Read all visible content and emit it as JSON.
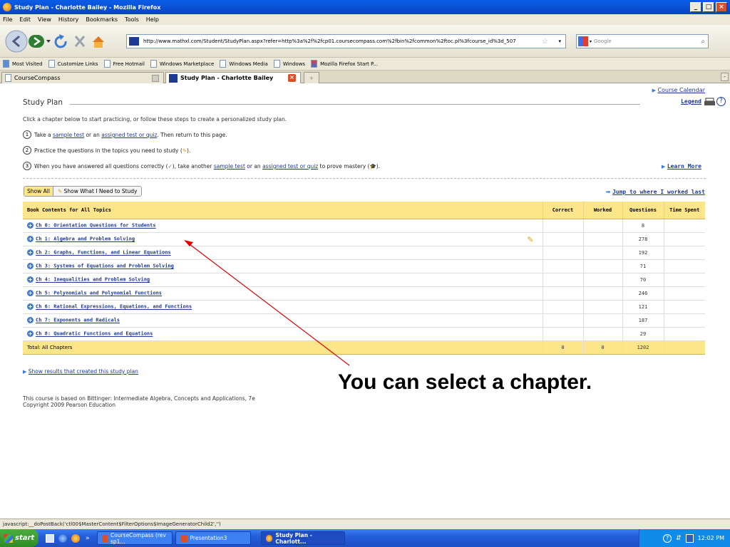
{
  "window": {
    "title": "Study Plan - Charlotte Bailey - Mozilla Firefox"
  },
  "menu": [
    "File",
    "Edit",
    "View",
    "History",
    "Bookmarks",
    "Tools",
    "Help"
  ],
  "address": {
    "url": "http://www.mathxl.com/Student/StudyPlan.aspx?refer=http%3a%2f%2fcp01.coursecompass.com%2fbin%2fcommon%2ftoc.pl%3fcourse_id%3d_507"
  },
  "search": {
    "placeholder": "Google"
  },
  "bookmarks": [
    "Most Visited",
    "Customize Links",
    "Free Hotmail",
    "Windows Marketplace",
    "Windows Media",
    "Windows",
    "Mozilla Firefox Start P..."
  ],
  "tabs": [
    "CourseCompass",
    "Study Plan - Charlotte Bailey"
  ],
  "page": {
    "title": "Study Plan",
    "course_calendar": "Course Calendar",
    "legend": "Legend",
    "intro": "Click a chapter below to start practicing, or follow these steps to create a personalized study plan.",
    "step1": {
      "num": "1",
      "a": "Take a ",
      "link1": "sample test",
      "b": " or an ",
      "link2": "assigned test or quiz",
      "c": ". Then return to this page."
    },
    "step2": {
      "num": "2",
      "a": "Practice the questions in the topics you need to study (",
      "c": ")."
    },
    "step3": {
      "num": "3",
      "a": "When you have answered all questions correctly (",
      "b": "), take another ",
      "link1": "sample test",
      "c": " or an ",
      "link2": "assigned test or quiz",
      "d": " to prove mastery (",
      "e": ")."
    },
    "learn_more": "Learn More",
    "filter": {
      "show_all": "Show All",
      "show_need": "Show What I Need to Study"
    },
    "jump": "Jump to where I worked last",
    "table": {
      "headers": {
        "topics": "Book Contents for All Topics",
        "correct": "Correct",
        "worked": "Worked",
        "questions": "Questions",
        "time": "Time Spent"
      },
      "rows": [
        {
          "chapter": "Ch 0: Orientation Questions for Students",
          "correct": "",
          "worked": "",
          "questions": "8",
          "time": ""
        },
        {
          "chapter": "Ch 1: Algebra and Problem Solving",
          "correct": "",
          "worked": "",
          "questions": "278",
          "time": ""
        },
        {
          "chapter": "Ch 2: Graphs, Functions, and Linear Equations",
          "correct": "",
          "worked": "",
          "questions": "192",
          "time": ""
        },
        {
          "chapter": "Ch 3: Systems of Equations and Problem Solving",
          "correct": "",
          "worked": "",
          "questions": "71",
          "time": ""
        },
        {
          "chapter": "Ch 4: Inequalities and Problem Solving",
          "correct": "",
          "worked": "",
          "questions": "70",
          "time": ""
        },
        {
          "chapter": "Ch 5: Polynomials and Polynomial Functions",
          "correct": "",
          "worked": "",
          "questions": "246",
          "time": ""
        },
        {
          "chapter": "Ch 6: Rational Expressions, Equations, and Functions",
          "correct": "",
          "worked": "",
          "questions": "121",
          "time": ""
        },
        {
          "chapter": "Ch 7: Exponents and Radicals",
          "correct": "",
          "worked": "",
          "questions": "187",
          "time": ""
        },
        {
          "chapter": "Ch 8: Quadratic Functions and Equations",
          "correct": "",
          "worked": "",
          "questions": "29",
          "time": ""
        }
      ],
      "total": {
        "label": "Total: All Chapters",
        "correct": "0",
        "worked": "0",
        "questions": "1202",
        "time": ""
      }
    },
    "show_results": "Show results that created this study plan",
    "footer_line1": "This course is based on Bittinger: Intermediate Algebra, Concepts and Applications, 7e",
    "footer_line2": "Copyright 2009 Pearson Education",
    "callout": "You can select a chapter."
  },
  "status": {
    "text": "javascript:__doPostBack('ctl00$MasterContent$FilterOptions$ImageGeneratorChild2','')"
  },
  "taskbar": {
    "start": "start",
    "items": [
      "CourseCompass (rev sp1...",
      "Presentation3",
      "Study Plan - Charlott..."
    ],
    "clock": "12:02 PM"
  }
}
